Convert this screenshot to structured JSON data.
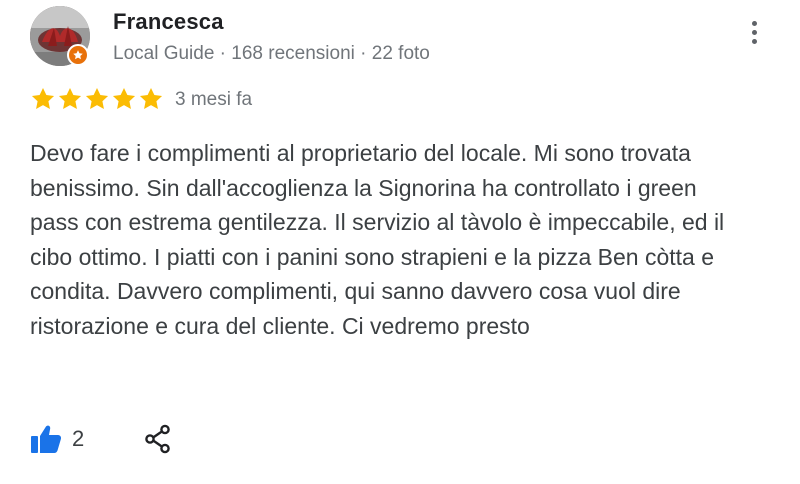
{
  "review": {
    "author": "Francesca",
    "meta": "Local Guide · 168 recensioni · 22 foto",
    "rating": 5,
    "rating_max": 5,
    "date": "3 mesi fa",
    "text": "Devo fare i complimenti al proprietario del locale. Mi sono trovata benissimo. Sin dall'accoglienza la Signorina ha controllato i green pass con estrema gentilezza. Il servizio al tàvolo è impeccabile, ed il cibo ottimo. I piatti con i panini sono strapieni e la pizza Ben còtta e condita. Davvero complimenti, qui sanno davvero cosa vuol dire ristorazione e cura del cliente. Ci vedremo presto",
    "likes": "2"
  },
  "icons": {
    "avatar": "avatar-photo",
    "badge": "local-guide-star-icon",
    "more": "more-vert-icon",
    "star": "star-icon",
    "like": "thumbs-up-icon",
    "share": "share-icon"
  },
  "colors": {
    "star": "#fbbc04",
    "like": "#1a73e8",
    "badge": "#e8710a",
    "secondary_text": "#70757a",
    "primary_text": "#3c4043"
  }
}
